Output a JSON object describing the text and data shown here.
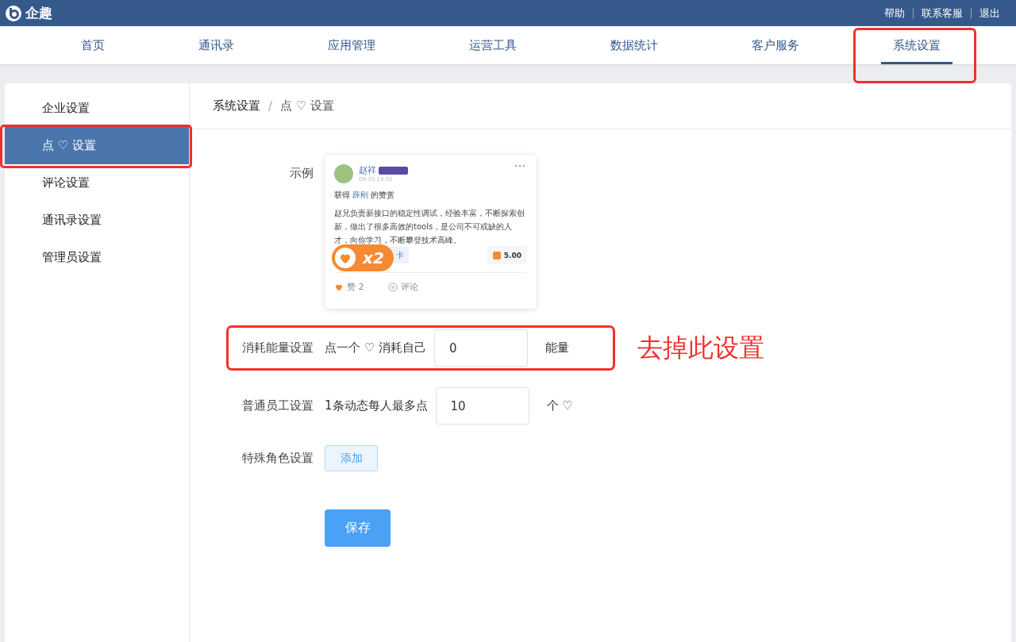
{
  "brand": "企趣",
  "top_links": [
    "帮助",
    "联系客服",
    "退出"
  ],
  "nav": [
    {
      "label": "首页",
      "selected": false,
      "highlighted": false
    },
    {
      "label": "通讯录",
      "selected": false,
      "highlighted": false
    },
    {
      "label": "应用管理",
      "selected": false,
      "highlighted": false
    },
    {
      "label": "运营工具",
      "selected": false,
      "highlighted": false
    },
    {
      "label": "数据统计",
      "selected": false,
      "highlighted": false
    },
    {
      "label": "客户服务",
      "selected": false,
      "highlighted": false
    },
    {
      "label": "系统设置",
      "selected": true,
      "highlighted": true
    }
  ],
  "sidebar": {
    "items": [
      {
        "label": "企业设置",
        "selected": false,
        "highlighted": false
      },
      {
        "label": "点 ♡ 设置",
        "selected": true,
        "highlighted": true
      },
      {
        "label": "评论设置",
        "selected": false,
        "highlighted": false
      },
      {
        "label": "通讯录设置",
        "selected": false,
        "highlighted": false
      },
      {
        "label": "管理员设置",
        "selected": false,
        "highlighted": false
      }
    ]
  },
  "breadcrumb": [
    "系统设置",
    "点 ♡ 设置"
  ],
  "breadcrumb_separator": "/",
  "example": {
    "label": "示例",
    "author": "赵祥",
    "time": "09-25 14:31",
    "title_prefix": "获得",
    "title_name": "薛刚",
    "title_suffix": "的赞赏",
    "body": "赵兄负责新接口的稳定性调试，经验丰富，不断探索创新，做出了很多高效的tools，是公司不可或缺的人才，向你学习，不断攀登技术高峰。",
    "multiplier": "x2",
    "card_button": "卡",
    "amount": "5.00",
    "likes": "赞 2",
    "comments": "评论"
  },
  "form": [
    {
      "kind": "input",
      "label": "消耗能量设置",
      "prefix": "点一个 ♡ 消耗自己",
      "value": "0",
      "suffix": "能量",
      "highlighted": true
    },
    {
      "kind": "input",
      "label": "普通员工设置",
      "prefix": "1条动态每人最多点",
      "value": "10",
      "suffix": "个 ♡",
      "highlighted": false
    },
    {
      "kind": "button",
      "label": "特殊角色设置",
      "button": "添加",
      "highlighted": false
    }
  ],
  "annotation": "去掉此设置",
  "save": "保存"
}
